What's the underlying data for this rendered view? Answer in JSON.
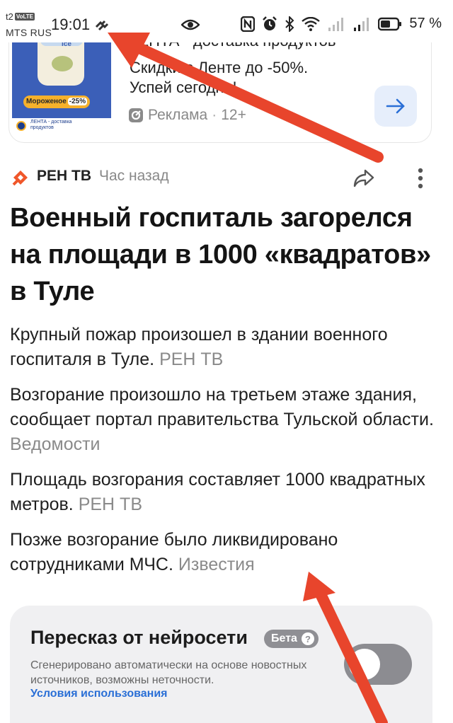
{
  "status_bar": {
    "carrier_top": "t2",
    "volte": "VoLTE",
    "carrier": "MTS RUS",
    "time": "19:01",
    "battery": "57 %"
  },
  "ad": {
    "title": "ЛЕНТА - доставка продуктов",
    "line1": "Скидки в Ленте до -50%.",
    "line2": "Успей сегодня!",
    "label": "Реклама",
    "age": "12+",
    "image": {
      "brand": "Ice",
      "promo_text": "Мороженое",
      "promo_pct": "-25%",
      "strip_text": "ЛЕНТА - доставка продуктов"
    }
  },
  "article": {
    "source": "РЕН ТВ",
    "time_ago": "Час назад",
    "headline": "Военный госпиталь загорелся на площади в 1000 «квадратов» в Туле",
    "paragraphs": [
      {
        "text": "Крупный пожар произошел в здании военного госпиталя в Туле.",
        "source": "РЕН ТВ"
      },
      {
        "text": "Возгорание произошло на третьем этаже здания, сообщает портал правительства Тульской области.",
        "source": "Ведомости"
      },
      {
        "text": "Площадь возгорания составляет 1000 квадратных метров.",
        "source": "РЕН ТВ"
      },
      {
        "text": "Позже возгорание было ликвидировано сотрудниками МЧС.",
        "source": "Известия"
      }
    ]
  },
  "summary": {
    "title": "Пересказ от нейросети",
    "badge": "Бета",
    "badge_help": "?",
    "description": "Сгенерировано автоматически на основе новостных источников, возможны неточности.",
    "link": "Условия использования",
    "toggle_on": false
  },
  "colors": {
    "annotation_arrow": "#e8452c",
    "link": "#2a6fd6",
    "source_muted": "#8a8a8a",
    "ren_tv_logo": "#f0572a"
  },
  "icons": [
    "signal-icon",
    "eye-icon",
    "nfc-icon",
    "alarm-icon",
    "bluetooth-icon",
    "wifi-icon",
    "battery-icon",
    "arrow-right-icon",
    "ad-icon",
    "ren-tv-logo-icon",
    "share-icon",
    "more-vertical-icon"
  ]
}
